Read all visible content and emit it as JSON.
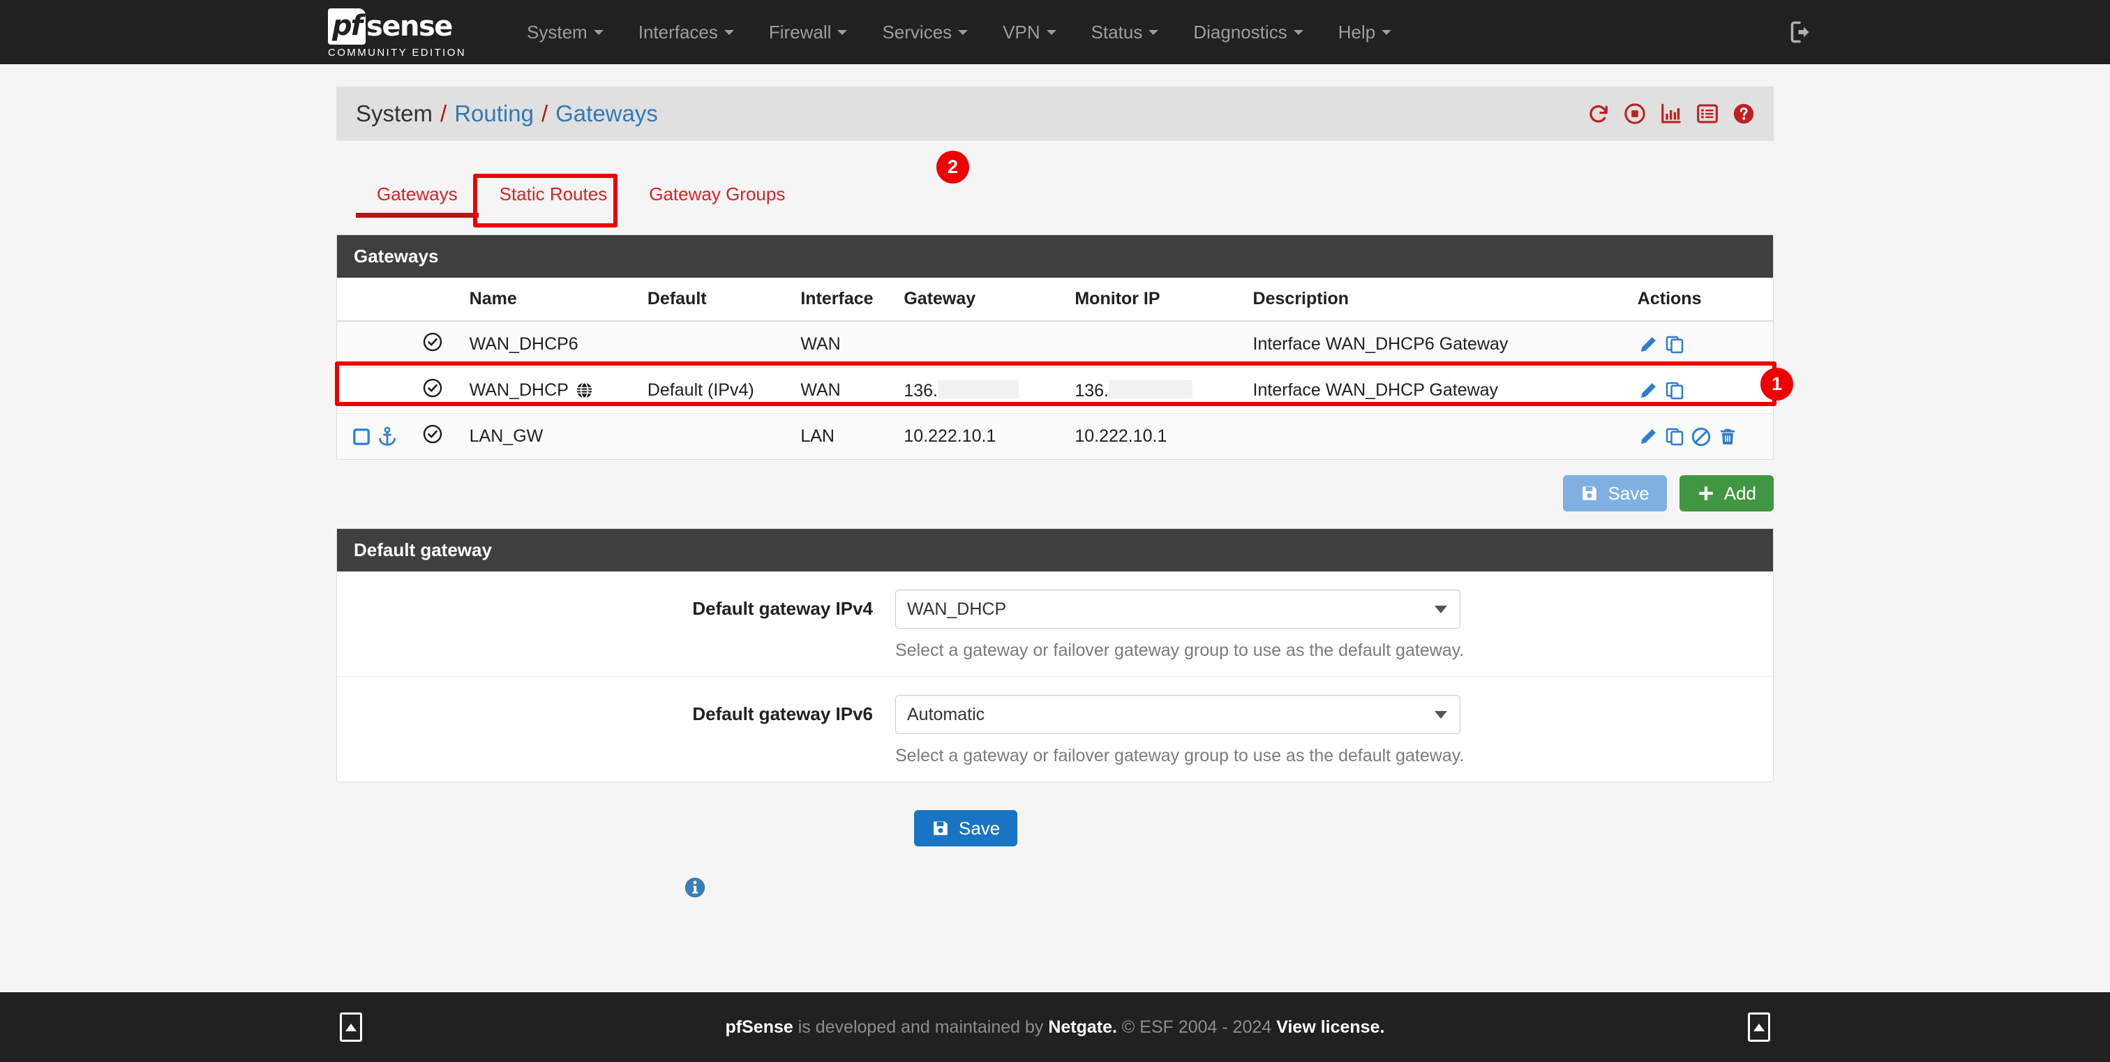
{
  "navbar": {
    "brand_logo_prefix": "pf",
    "brand_logo_word": "sense",
    "brand_subtitle": "COMMUNITY EDITION",
    "menu": [
      {
        "label": "System",
        "has_caret": true
      },
      {
        "label": "Interfaces",
        "has_caret": true
      },
      {
        "label": "Firewall",
        "has_caret": true
      },
      {
        "label": "Services",
        "has_caret": true
      },
      {
        "label": "VPN",
        "has_caret": true
      },
      {
        "label": "Status",
        "has_caret": true
      },
      {
        "label": "Diagnostics",
        "has_caret": true
      },
      {
        "label": "Help",
        "has_caret": true
      }
    ],
    "logout_icon": "logout-icon"
  },
  "breadcrumb": {
    "items": [
      "System",
      "Routing",
      "Gateways"
    ],
    "separator": "/",
    "icons": [
      "reload-icon",
      "stop-circle-icon",
      "bar-chart-icon",
      "list-icon",
      "help-circle-icon"
    ]
  },
  "tabs": [
    {
      "label": "Gateways",
      "active": true
    },
    {
      "label": "Static Routes",
      "active": false
    },
    {
      "label": "Gateway Groups",
      "active": false
    }
  ],
  "annotations": [
    {
      "id": "1",
      "target": "gateway-row-lan-gw"
    },
    {
      "id": "2",
      "target": "tab-static-routes"
    }
  ],
  "gateways_panel": {
    "title": "Gateways",
    "columns": [
      "",
      "",
      "Name",
      "Default",
      "Interface",
      "Gateway",
      "Monitor IP",
      "Description",
      "Actions"
    ],
    "rows": [
      {
        "select": "",
        "status_icon": "check-circle-icon",
        "name": "WAN_DHCP6",
        "name_icon": "",
        "default": "",
        "interface": "WAN",
        "gateway": "",
        "gateway_redacted": false,
        "monitor_ip": "",
        "monitor_redacted": false,
        "description": "Interface WAN_DHCP6 Gateway",
        "actions": [
          "edit-pencil-icon",
          "copy-icon"
        ]
      },
      {
        "select": "",
        "status_icon": "check-circle-icon",
        "name": "WAN_DHCP",
        "name_icon": "globe-icon",
        "default": "Default (IPv4)",
        "interface": "WAN",
        "gateway": "136.",
        "gateway_redacted": true,
        "monitor_ip": "136.",
        "monitor_redacted": true,
        "description": "Interface WAN_DHCP Gateway",
        "actions": [
          "edit-pencil-icon",
          "copy-icon"
        ]
      },
      {
        "select": "checkbox",
        "anchor_icon": "anchor-icon",
        "status_icon": "check-circle-icon",
        "name": "LAN_GW",
        "name_icon": "",
        "default": "",
        "interface": "LAN",
        "gateway": "10.222.10.1",
        "gateway_redacted": false,
        "monitor_ip": "10.222.10.1",
        "monitor_redacted": false,
        "description": "",
        "actions": [
          "edit-pencil-icon",
          "copy-icon",
          "ban-icon",
          "trash-icon"
        ],
        "highlighted": true
      }
    ],
    "buttons": {
      "save_label": "Save",
      "save_icon": "save-floppy-icon",
      "add_label": "Add",
      "add_icon": "plus-icon"
    }
  },
  "default_gateway_panel": {
    "title": "Default gateway",
    "fields": [
      {
        "label": "Default gateway IPv4",
        "value": "WAN_DHCP",
        "help": "Select a gateway or failover gateway group to use as the default gateway."
      },
      {
        "label": "Default gateway IPv6",
        "value": "Automatic",
        "help": "Select a gateway or failover gateway group to use as the default gateway."
      }
    ]
  },
  "bottom_save": {
    "label": "Save",
    "icon": "save-floppy-icon"
  },
  "info_icon": "info-circle-icon",
  "footer": {
    "brand": "pfSense",
    "text_middle": " is developed and maintained by ",
    "netgate": "Netgate.",
    "copyright": " © ESF 2004 - 2024 ",
    "license_link": "View license.",
    "scroll_icon": "scroll-top-icon"
  },
  "colors": {
    "navbar_bg": "#212121",
    "accent_red": "#e02020",
    "annotation_red": "#ee0000",
    "link_blue": "#337ab7",
    "icon_blue": "#2d7dd2",
    "panel_head": "#3f3f3f",
    "add_green": "#419641",
    "save_blue": "#1a74c4",
    "save_disabled_blue": "#7fb0e0"
  }
}
